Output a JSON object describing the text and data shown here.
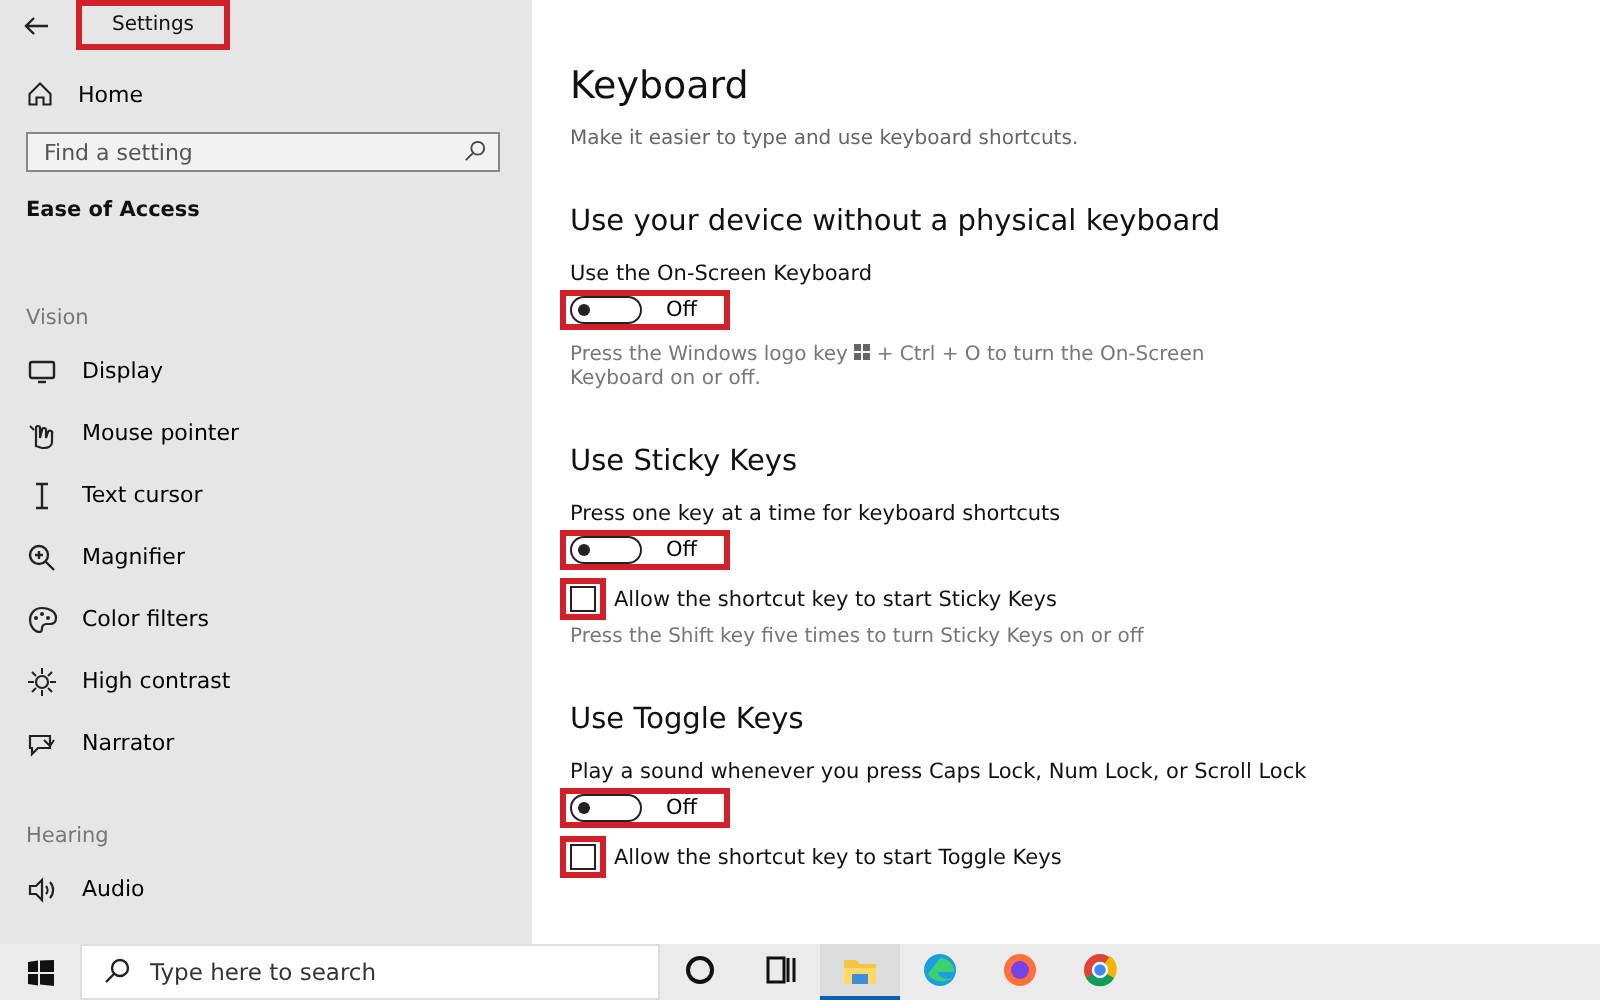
{
  "window": {
    "title": "Settings",
    "title_highlighted": true
  },
  "sidebar": {
    "home": "Home",
    "search": {
      "placeholder": "Find a setting"
    },
    "category": "Ease of Access",
    "groups": [
      {
        "heading": "Vision",
        "items": [
          {
            "label": "Display",
            "selected": false
          },
          {
            "label": "Mouse pointer",
            "selected": false
          },
          {
            "label": "Text cursor",
            "selected": false
          },
          {
            "label": "Magnifier",
            "selected": false
          },
          {
            "label": "Color filters",
            "selected": false
          },
          {
            "label": "High contrast",
            "selected": false
          },
          {
            "label": "Narrator",
            "selected": false
          }
        ]
      },
      {
        "heading": "Hearing",
        "items": [
          {
            "label": "Audio",
            "selected": false
          }
        ]
      }
    ]
  },
  "page": {
    "title": "Keyboard",
    "subtitle": "Make it easier to type and use keyboard shortcuts.",
    "sections": [
      {
        "heading": "Use your device without a physical keyboard",
        "rows": [
          {
            "kind": "label",
            "text": "Use the On-Screen Keyboard"
          },
          {
            "kind": "toggle",
            "on": false,
            "state_text": "Off",
            "highlighted": true
          },
          {
            "kind": "keynote",
            "before": "Press the Windows logo key",
            "after": "+ Ctrl + O to turn the On-Screen Keyboard on or off."
          }
        ]
      },
      {
        "heading": "Use Sticky Keys",
        "rows": [
          {
            "kind": "label",
            "text": "Press one key at a time for keyboard shortcuts"
          },
          {
            "kind": "toggle",
            "on": false,
            "state_text": "Off",
            "highlighted": true
          },
          {
            "kind": "checkbox",
            "label": "Allow the shortcut key to start Sticky Keys",
            "checked": false,
            "highlighted": true
          },
          {
            "kind": "note",
            "text": "Press the Shift key five times to turn Sticky Keys on or off"
          }
        ]
      },
      {
        "heading": "Use Toggle Keys",
        "rows": [
          {
            "kind": "label",
            "text": "Play a sound whenever you press Caps Lock, Num Lock, or Scroll Lock"
          },
          {
            "kind": "toggle",
            "on": false,
            "state_text": "Off",
            "highlighted": true
          },
          {
            "kind": "checkbox",
            "label": "Allow the shortcut key to start Toggle Keys",
            "checked": false,
            "highlighted": true
          }
        ]
      }
    ]
  },
  "taskbar": {
    "search": {
      "placeholder": "Type here to search"
    },
    "apps": [
      {
        "kind": "cortana",
        "active": false
      },
      {
        "kind": "taskview",
        "active": false
      },
      {
        "kind": "explorer",
        "active": true
      },
      {
        "kind": "edge",
        "active": false
      },
      {
        "kind": "firefox",
        "active": false
      },
      {
        "kind": "chrome",
        "active": false
      }
    ]
  }
}
